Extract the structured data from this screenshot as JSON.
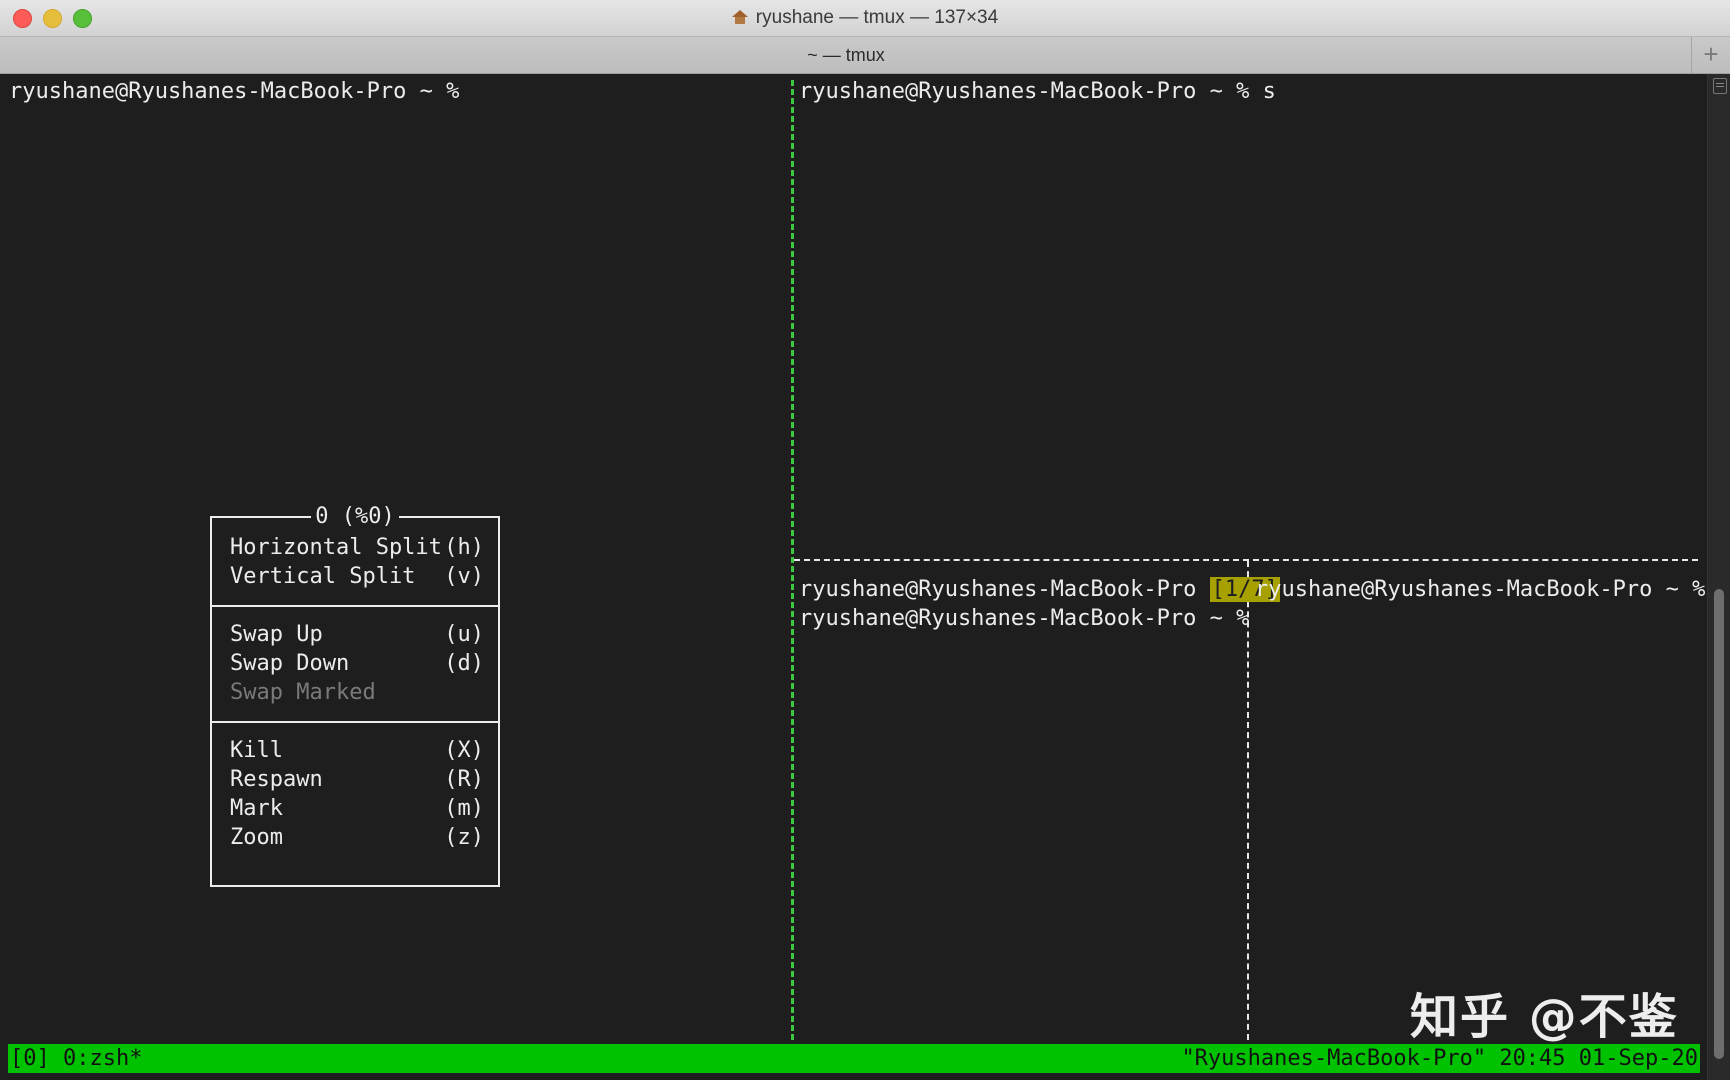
{
  "window": {
    "title": "ryushane — tmux — 137×34",
    "tab_title": "~ — tmux",
    "tab_add": "+"
  },
  "colors": {
    "active_pane_border": "#3cc83c",
    "status_bar": "#00c200",
    "pane_index_badge": "#a6a000"
  },
  "pane_left": {
    "prompt": "ryushane@Ryushanes-MacBook-Pro ~ %"
  },
  "pane_top_right": {
    "prompt": "ryushane@Ryushanes-MacBook-Pro ~ % s"
  },
  "pane_bottom_middle": {
    "line1": "ryushane@Ryushanes-MacBook-Pro",
    "badge": "[1/7]",
    "line2": "ryushane@Ryushanes-MacBook-Pro ~ %"
  },
  "pane_bottom_right": {
    "prompt": "ryushane@Ryushanes-MacBook-Pro ~ %"
  },
  "menu": {
    "title": "0 (%0)",
    "items": [
      {
        "label": "Horizontal Split",
        "key": "(h)"
      },
      {
        "label": "Vertical Split",
        "key": "(v)"
      },
      {
        "label": "Swap Up",
        "key": "(u)"
      },
      {
        "label": "Swap Down",
        "key": "(d)"
      },
      {
        "label": "Swap Marked",
        "key": ""
      },
      {
        "label": "Kill",
        "key": "(X)"
      },
      {
        "label": "Respawn",
        "key": "(R)"
      },
      {
        "label": "Mark",
        "key": "(m)"
      },
      {
        "label": "Zoom",
        "key": "(z)"
      }
    ]
  },
  "status_bar": {
    "left": "[0] 0:zsh*",
    "right": "\"Ryushanes-MacBook-Pro\" 20:45 01-Sep-20"
  },
  "watermark": "知乎 @不鉴"
}
